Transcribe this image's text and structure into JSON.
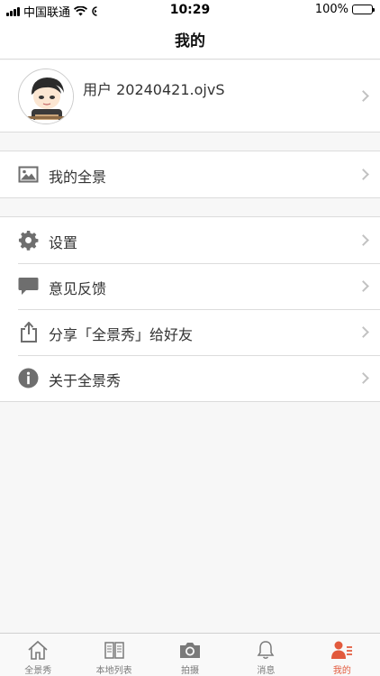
{
  "status_bar": {
    "carrier": "中国联通",
    "time": "10:29",
    "battery": "100%"
  },
  "nav": {
    "title": "我的"
  },
  "profile": {
    "username": "用户 20240421.ojvS"
  },
  "menu_group_1": [
    {
      "label": "我的全景",
      "icon": "image-icon"
    }
  ],
  "menu_group_2": [
    {
      "label": "设置",
      "icon": "gear-icon"
    },
    {
      "label": "意见反馈",
      "icon": "chat-bubble-icon"
    },
    {
      "label": "分享「全景秀」给好友",
      "icon": "share-icon"
    },
    {
      "label": "关于全景秀",
      "icon": "info-icon"
    }
  ],
  "tabbar": [
    {
      "label": "全景秀",
      "icon": "home-icon"
    },
    {
      "label": "本地列表",
      "icon": "book-icon"
    },
    {
      "label": "拍摄",
      "icon": "camera-icon"
    },
    {
      "label": "消息",
      "icon": "bell-icon"
    },
    {
      "label": "我的",
      "icon": "person-list-icon",
      "active": true
    }
  ],
  "colors": {
    "accent": "#e25a3d",
    "icon_gray": "#6e6e6e"
  }
}
